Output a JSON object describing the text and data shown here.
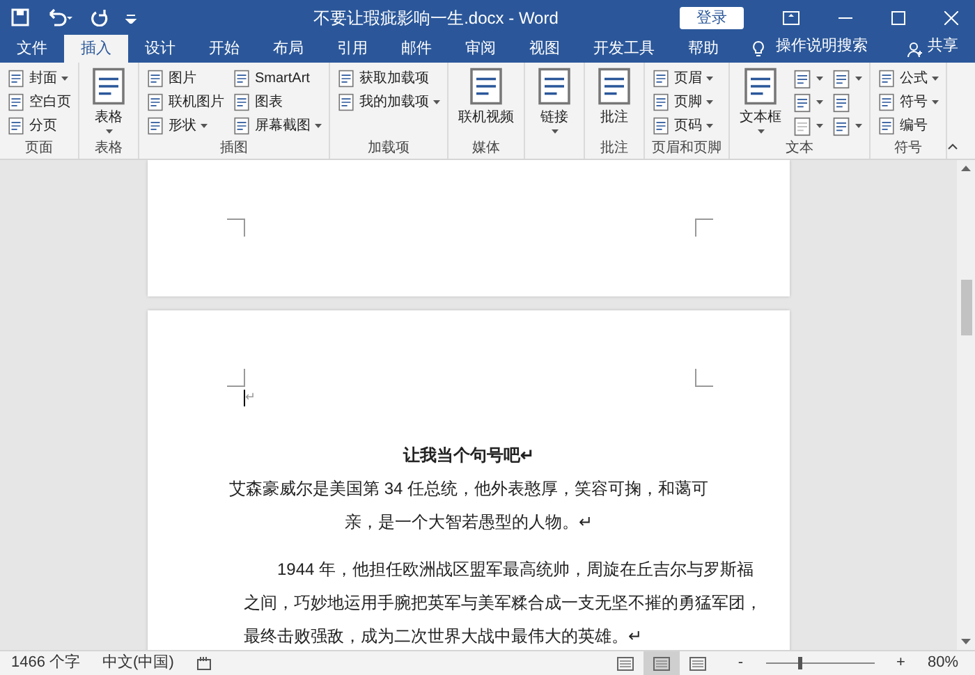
{
  "window": {
    "title": "不要让瑕疵影响一生.docx - Word",
    "sign_in": "登录"
  },
  "tabs": [
    {
      "label": "文件",
      "selected": false
    },
    {
      "label": "插入",
      "selected": true
    },
    {
      "label": "设计",
      "selected": false
    },
    {
      "label": "开始",
      "selected": false
    },
    {
      "label": "布局",
      "selected": false
    },
    {
      "label": "引用",
      "selected": false
    },
    {
      "label": "邮件",
      "selected": false
    },
    {
      "label": "审阅",
      "selected": false
    },
    {
      "label": "视图",
      "selected": false
    },
    {
      "label": "开发工具",
      "selected": false
    },
    {
      "label": "帮助",
      "selected": false
    }
  ],
  "tell_me": "操作说明搜索",
  "share": "共享",
  "ribbon": {
    "groups": [
      {
        "label": "页面",
        "columns": [
          [
            {
              "kind": "small",
              "label": "封面",
              "dropdown": true
            },
            {
              "kind": "small",
              "label": "空白页",
              "dropdown": false
            },
            {
              "kind": "small",
              "label": "分页",
              "dropdown": false
            }
          ]
        ]
      },
      {
        "label": "表格",
        "columns": [
          [
            {
              "kind": "large",
              "label": "表格",
              "dropdown": true
            }
          ]
        ]
      },
      {
        "label": "插图",
        "columns": [
          [
            {
              "kind": "small",
              "label": "图片",
              "dropdown": false
            },
            {
              "kind": "small",
              "label": "联机图片",
              "dropdown": false
            },
            {
              "kind": "small",
              "label": "形状",
              "dropdown": true
            }
          ],
          [
            {
              "kind": "small",
              "label": "SmartArt",
              "dropdown": false
            },
            {
              "kind": "small",
              "label": "图表",
              "dropdown": false
            },
            {
              "kind": "small",
              "label": "屏幕截图",
              "dropdown": true
            }
          ]
        ]
      },
      {
        "label": "加载项",
        "columns": [
          [
            {
              "kind": "small",
              "label": "获取加载项",
              "dropdown": false
            },
            {
              "kind": "small",
              "label": "我的加载项",
              "dropdown": true
            }
          ]
        ]
      },
      {
        "label": "媒体",
        "columns": [
          [
            {
              "kind": "large",
              "label": "联机视频",
              "dropdown": false
            }
          ]
        ]
      },
      {
        "columns": [
          [
            {
              "kind": "large",
              "label": "链接",
              "dropdown": true
            }
          ]
        ]
      },
      {
        "label": "批注",
        "columns": [
          [
            {
              "kind": "large",
              "label": "批注",
              "dropdown": false
            }
          ]
        ]
      },
      {
        "label": "页眉和页脚",
        "columns": [
          [
            {
              "kind": "small",
              "label": "页眉",
              "dropdown": true
            },
            {
              "kind": "small",
              "label": "页脚",
              "dropdown": true
            },
            {
              "kind": "small",
              "label": "页码",
              "dropdown": true
            }
          ]
        ]
      },
      {
        "label": "文本",
        "columns": [
          [
            {
              "kind": "large",
              "label": "文本框",
              "dropdown": true
            }
          ],
          [
            {
              "kind": "icon",
              "dropdown": true,
              "disabled": false
            },
            {
              "kind": "icon",
              "dropdown": true,
              "disabled": false
            },
            {
              "kind": "icon",
              "dropdown": true,
              "disabled": true
            }
          ],
          [
            {
              "kind": "icon",
              "dropdown": true,
              "disabled": false
            },
            {
              "kind": "icon",
              "dropdown": false,
              "disabled": false
            },
            {
              "kind": "icon",
              "dropdown": true,
              "disabled": false
            }
          ]
        ]
      },
      {
        "label": "符号",
        "columns": [
          [
            {
              "kind": "small",
              "label": "公式",
              "dropdown": true
            },
            {
              "kind": "small",
              "label": "符号",
              "dropdown": true
            },
            {
              "kind": "small",
              "label": "编号",
              "dropdown": false
            }
          ]
        ]
      }
    ]
  },
  "document": {
    "paragraphs": [
      {
        "kind": "cursor",
        "lines": [
          "↵"
        ]
      },
      {
        "kind": "heading",
        "lines": [
          "让我当个句号吧↵"
        ]
      },
      {
        "kind": "centered",
        "lines": [
          "艾森豪威尔是美国第 34 任总统，他外表憨厚，笑容可掬，和蔼可",
          "亲，是一个大智若愚型的人物。↵"
        ]
      },
      {
        "kind": "body",
        "lines": [
          "1944 年，他担任欧洲战区盟军最高统帅，周旋在丘吉尔与罗斯福",
          "之间，巧妙地运用手腕把英军与美军糅合成一支无坚不摧的勇猛军团，",
          "最终击败强敌，成为二次世界大战中最伟大的英雄。↵"
        ]
      }
    ]
  },
  "status_bar": {
    "word_count": "1466 个字",
    "language": "中文(中国)",
    "views": [
      {
        "selected": false
      },
      {
        "selected": true
      },
      {
        "selected": false
      }
    ],
    "zoom": {
      "zoom_out": "-",
      "zoom_in": "+",
      "level": 0.31,
      "reading": "80%"
    }
  }
}
